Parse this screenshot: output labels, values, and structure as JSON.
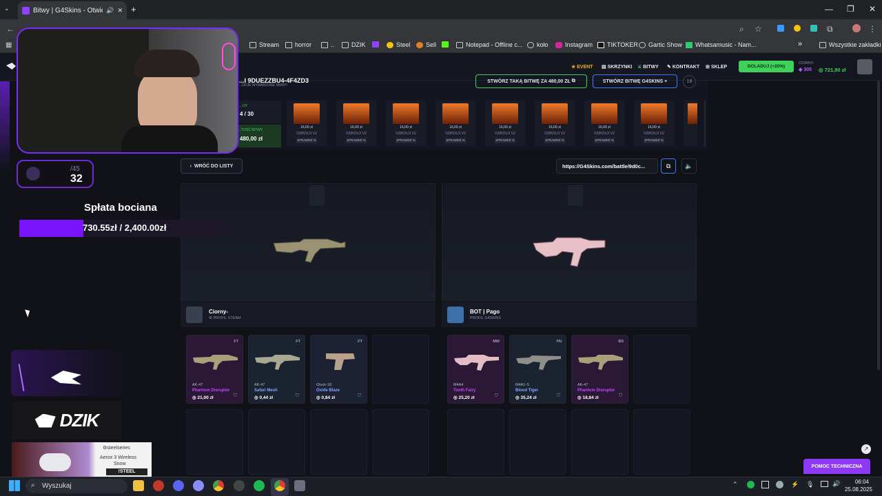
{
  "browser": {
    "tab_title": "Bitwy | G4Skins - Otwieraj s",
    "new_tab": "+",
    "win_min": "—",
    "win_max": "❐",
    "win_close": "✕",
    "bookmarks": [
      "Stream",
      "horror",
      "..",
      "DZIK",
      "Steel",
      "Sell",
      "Notepad - Offline c...",
      "koło",
      "Instagram",
      "TIKTOKER",
      "Gartic Show",
      "Whatsamusic - Nam..."
    ],
    "bookmarks_more": "»",
    "all_bookmarks": "Wszystkie zakładki"
  },
  "site": {
    "nav": {
      "event": "EVENT",
      "skrzynki": "SKRZYNKI",
      "bitwy": "BITWY",
      "kontrakt": "KONTRAKT",
      "sklep": "SKLEP"
    },
    "doladuj": "DOLADUJ (+20%)",
    "user": {
      "name": "CIORNY-",
      "points": "305",
      "balance": "721,80 zł"
    }
  },
  "battle": {
    "header_fragment": "...ODJE WYMARZONE SKINY!",
    "header_id": "...I 9DUEZZBU4-4F4ZD3",
    "create_same": "STWÓRZ TAKĄ BITWĘ ZA 480,00 ZŁ",
    "create_g4": "STWÓRZ BITWĘ G4SKINS",
    "badge": "18",
    "rounds_label": "...OY",
    "rounds": "4 / 30",
    "value_label": "...TOŚĆ BITWY",
    "value": "480,00 zł",
    "cases": [
      {
        "name": "DZIKOLO V2",
        "price": "16,00 zł",
        "btn": "SPRAWDŹ %"
      },
      {
        "name": "DZIKOLO V2",
        "price": "16,00 zł",
        "btn": "SPRAWDŹ %"
      },
      {
        "name": "DZIKOLO V2",
        "price": "16,00 zł",
        "btn": "SPRAWDŹ %"
      },
      {
        "name": "DZIKOLO V2",
        "price": "16,00 zł",
        "btn": "SPRAWDŹ %"
      },
      {
        "name": "DZIKOLO V2",
        "price": "16,00 zł",
        "btn": "SPRAWDŹ %"
      },
      {
        "name": "DZIKOLO V2",
        "price": "16,00 zł",
        "btn": "SPRAWDŹ %"
      },
      {
        "name": "DZIKOLO V2",
        "price": "16,00 zł",
        "btn": "SPRAWDŹ %"
      },
      {
        "name": "DZIKOLO V2",
        "price": "16,00 zł",
        "btn": "SPRAWDŹ %"
      }
    ],
    "back": "WRÓĆ DO LISTY",
    "url": "https://G4Skins.com/battle/9d0c...",
    "players": [
      {
        "name": "Ciorny-",
        "sub": "PROFIL STEAM"
      },
      {
        "name": "BOT | Pago",
        "sub": "PROFIL G4SKINS"
      }
    ],
    "items_left": [
      {
        "cond": "FT",
        "weapon": "AK-47",
        "skin": "Phantom Disruptor",
        "price": "21,00 zł",
        "color": "#c648ff",
        "bg": "#2a1836"
      },
      {
        "cond": "FT",
        "weapon": "AK-47",
        "skin": "Safari Mesh",
        "price": "0,44 zł",
        "color": "#7fa7ff",
        "bg": "#1b2230"
      },
      {
        "cond": "FT",
        "weapon": "Glock-18",
        "skin": "Oxide Blaze",
        "price": "0,84 zł",
        "color": "#7fa7ff",
        "bg": "#1c2233"
      }
    ],
    "items_right": [
      {
        "cond": "MW",
        "weapon": "M4A4",
        "skin": "Tooth Fairy",
        "price": "25,20 zł",
        "color": "#c648ff",
        "bg": "#2a1836"
      },
      {
        "cond": "FN",
        "weapon": "M4A1-S",
        "skin": "Blood Tiger",
        "price": "35,24 zł",
        "color": "#7fa7ff",
        "bg": "#1b2230"
      },
      {
        "cond": "BS",
        "weapon": "AK-47",
        "skin": "Phantom Disruptor",
        "price": "18,84 zł",
        "color": "#c648ff",
        "bg": "#2a1836"
      }
    ]
  },
  "overlay": {
    "counter_total": "/45",
    "counter_value": "32",
    "goal_title": "Spłata bociana",
    "goal_progress_fraction": 0.305,
    "goal_text": "730.55zł / 2,400.00zł",
    "brand": "DZIK",
    "ad_brand": "steelseries",
    "ad_product": "Aerox 3 Wireless",
    "ad_variant": "Snow",
    "ad_cmd": "!STEEL"
  },
  "support": "POMOC TECHNICZNA",
  "taskbar": {
    "search": "Wyszukaj",
    "time": "06:04",
    "date": "25.08.2025"
  }
}
